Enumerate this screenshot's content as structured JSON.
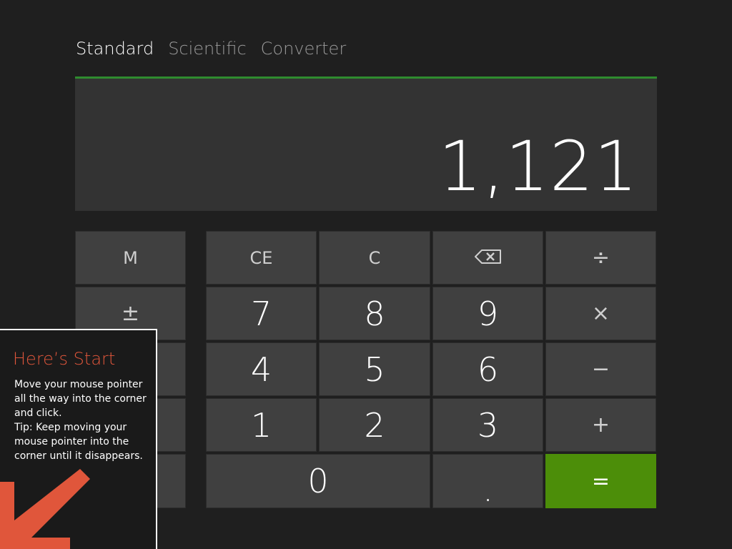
{
  "tabs": [
    {
      "label": "Standard",
      "active": true
    },
    {
      "label": "Scientific",
      "active": false
    },
    {
      "label": "Converter",
      "active": false
    }
  ],
  "display": {
    "value": "1,121"
  },
  "accent_colors": {
    "display_border": "#2e8b2e",
    "equals": "#4c8e09",
    "tooltip_title": "#e0563b"
  },
  "keys": {
    "memory": "M",
    "plus_minus": "±",
    "ce": "CE",
    "c": "C",
    "backspace_icon": "backspace-icon",
    "divide": "÷",
    "multiply": "×",
    "minus": "−",
    "plus": "+",
    "equals": "=",
    "n7": "7",
    "n8": "8",
    "n9": "9",
    "n4": "4",
    "n5": "5",
    "n6": "6",
    "n1": "1",
    "n2": "2",
    "n3": "3",
    "n0": "0",
    "decimal": "."
  },
  "tooltip": {
    "title": "Here’s Start",
    "lines": [
      "Move your mouse pointer",
      "all the way into the corner",
      "and click.",
      "Tip: Keep moving your",
      "mouse pointer into the",
      "corner until it disappears."
    ],
    "arrow_icon": "arrow-down-left-icon"
  }
}
